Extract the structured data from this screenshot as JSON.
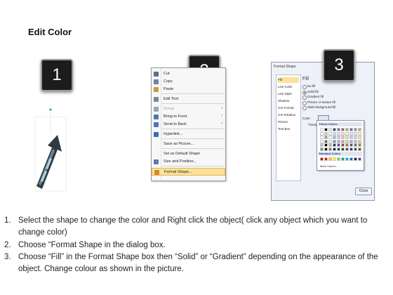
{
  "page": {
    "title": "Edit Color"
  },
  "badges": [
    "1",
    "2",
    "3"
  ],
  "context_menu": {
    "items": [
      {
        "label": "Cut",
        "icon": "scissors-icon",
        "color": "#5a6f8f",
        "submenu": false,
        "disabled": false
      },
      {
        "label": "Copy",
        "icon": "copy-icon",
        "color": "#6d84a8",
        "submenu": false,
        "disabled": false
      },
      {
        "label": "Paste",
        "icon": "paste-icon",
        "color": "#c79a3a",
        "submenu": false,
        "disabled": false
      },
      {
        "label": "Edit Text",
        "icon": "edit-text-icon",
        "color": "#7c8796",
        "submenu": false,
        "disabled": false
      },
      {
        "label": "Group",
        "icon": "group-icon",
        "color": "#9aa6b6",
        "submenu": true,
        "disabled": true
      },
      {
        "label": "Bring to Front",
        "icon": "bring-front-icon",
        "color": "#4f77b8",
        "submenu": true,
        "disabled": false
      },
      {
        "label": "Send to Back",
        "icon": "send-back-icon",
        "color": "#4f77b8",
        "submenu": true,
        "disabled": false
      },
      {
        "label": "Hyperlink...",
        "icon": "hyperlink-icon",
        "color": "#3b6db3",
        "submenu": false,
        "disabled": false
      },
      {
        "label": "Save as Picture...",
        "icon": "",
        "color": "",
        "submenu": false,
        "disabled": false
      },
      {
        "label": "Set as Default Shape",
        "icon": "",
        "color": "",
        "submenu": false,
        "disabled": false
      },
      {
        "label": "Size and Position...",
        "icon": "size-position-icon",
        "color": "#5d7ba6",
        "submenu": false,
        "disabled": false
      },
      {
        "label": "Format Shape...",
        "icon": "format-shape-icon",
        "color": "#d38a2a",
        "submenu": false,
        "disabled": false,
        "highlighted": true
      }
    ]
  },
  "dialog": {
    "title": "Format Shape",
    "nav": [
      "Fill",
      "Line Color",
      "Line Style",
      "Shadow",
      "3-D Format",
      "3-D Rotation",
      "Picture",
      "Text Box"
    ],
    "selected_nav": "Fill",
    "fill_heading": "Fill",
    "options": [
      {
        "label": "No fill",
        "checked": false
      },
      {
        "label": "Solid fill",
        "checked": true
      },
      {
        "label": "Gradient fill",
        "checked": false
      },
      {
        "label": "Picture or texture fill",
        "checked": false
      },
      {
        "label": "Slide background fill",
        "checked": false
      }
    ],
    "color_label": "Color:",
    "transparency_label": "Transpa",
    "palette": {
      "theme_header": "Theme Colors",
      "standard_header": "Standard Colors",
      "more_label": "More Colors...",
      "theme_base": [
        "#ffffff",
        "#000000",
        "#eeece1",
        "#1f497d",
        "#4f81bd",
        "#c0504d",
        "#9bbb59",
        "#8064a2",
        "#4bacc6",
        "#f79646"
      ],
      "standard": [
        "#c00000",
        "#ff0000",
        "#ffc000",
        "#ffff00",
        "#92d050",
        "#00b050",
        "#00b0f0",
        "#0070c0",
        "#002060",
        "#7030a0"
      ]
    },
    "close_label": "Close"
  },
  "instructions": [
    {
      "num": "1.",
      "text": "Select the shape to change the color and Right click the object( click any object which you want to change color)"
    },
    {
      "num": "2.",
      "text": "Choose “Format Shape in the dialog box."
    },
    {
      "num": "3.",
      "text": "Choose “Fill” in the Format Shape box then “Solid” or “Gradient” depending on the appearance of the object. Change colour as shown in the picture."
    }
  ]
}
